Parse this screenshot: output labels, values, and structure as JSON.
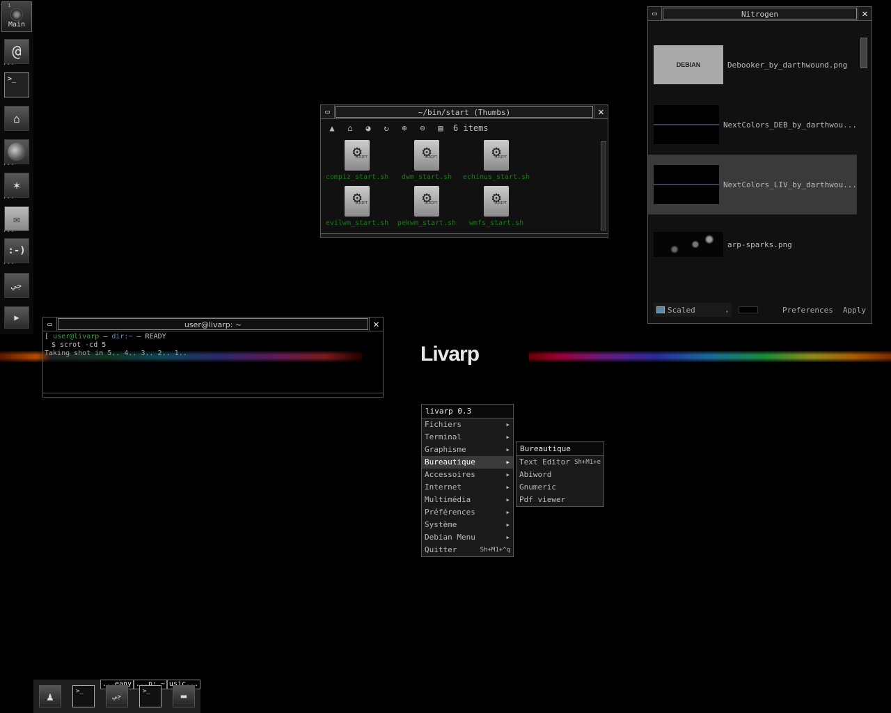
{
  "colors": {
    "desktop_bg": "#000000",
    "selected_bg": "#3a3a3a",
    "script_label": "#1a7a1a",
    "term_user": "#33aa33",
    "term_dir": "#6688cc"
  },
  "wallpaper": {
    "logo_text": "Livarp"
  },
  "dock": {
    "main_label": "Main",
    "main_index": "1",
    "items": [
      {
        "icon": "debian-swirl-icon"
      },
      {
        "icon": "terminal-icon",
        "glyph": ">_"
      },
      {
        "icon": "home-folder-icon"
      },
      {
        "icon": "web-browser-icon"
      },
      {
        "icon": "graphics-icon"
      },
      {
        "icon": "mail-icon"
      },
      {
        "icon": "chat-icon",
        "glyph": ":-)"
      },
      {
        "icon": "arabic-text-icon"
      },
      {
        "icon": "video-player-icon"
      }
    ]
  },
  "thumbs_window": {
    "title": "~/bin/start (Thumbs)",
    "item_count": "6 items",
    "script_badge": "SCRIPT",
    "files": [
      "compiz_start.sh",
      "dwm_start.sh",
      "echinus_start.sh",
      "evilwm_start.sh",
      "pekwm_start.sh",
      "wmfs_start.sh"
    ]
  },
  "nitrogen_window": {
    "title": "Nitrogen",
    "items": [
      {
        "name": "Debooker_by_darthwound.png",
        "thumb_text": "DEBIAN"
      },
      {
        "name": "NextColors_DEB_by_darthwou..."
      },
      {
        "name": "NextColors_LIV_by_darthwou...",
        "selected": true
      },
      {
        "name": "arp-sparks.png"
      }
    ],
    "mode": "Scaled",
    "preferences_label": "Preferences",
    "apply_label": "Apply"
  },
  "terminal_window": {
    "title": "user@livarp: ~",
    "prompt_open": "[",
    "prompt_user": "user@livarp",
    "prompt_sep": " – ",
    "prompt_dir": "dir:~",
    "prompt_status": " – READY",
    "command": "$ scrot -cd 5",
    "output": "Taking shot in 5.. 4.. 3.. 2.. 1.."
  },
  "menu": {
    "title": "livarp 0.3",
    "items": [
      {
        "label": "Fichiers",
        "sub": true
      },
      {
        "label": "Terminal",
        "sub": true
      },
      {
        "label": "Graphisme",
        "sub": true
      },
      {
        "label": "Bureautique",
        "sub": true,
        "active": true
      },
      {
        "label": "Accessoires",
        "sub": true
      },
      {
        "label": "Internet",
        "sub": true
      },
      {
        "label": "Multimédia",
        "sub": true
      },
      {
        "label": "Préférences",
        "sub": true
      },
      {
        "label": "Système",
        "sub": true
      },
      {
        "label": "Debian Menu",
        "sub": true
      },
      {
        "label": "Quitter",
        "shortcut": "Sh+M1+^q"
      }
    ],
    "submenu": {
      "title": "Bureautique",
      "items": [
        {
          "label": "Text Editor",
          "shortcut": "Sh+M1+e"
        },
        {
          "label": "Abiword"
        },
        {
          "label": "Gnumeric"
        },
        {
          "label": "Pdf viewer"
        }
      ]
    }
  },
  "taskbar": {
    "items": [
      {
        "icon": "suit-icon"
      },
      {
        "icon": "terminal-icon",
        "glyph": ">_"
      },
      {
        "icon": "arabic-text-icon",
        "label": "...eany"
      },
      {
        "icon": "terminal-icon",
        "glyph": ">_",
        "label": "...p: ~"
      },
      {
        "icon": "folder-icon",
        "label": "usic..."
      }
    ]
  }
}
